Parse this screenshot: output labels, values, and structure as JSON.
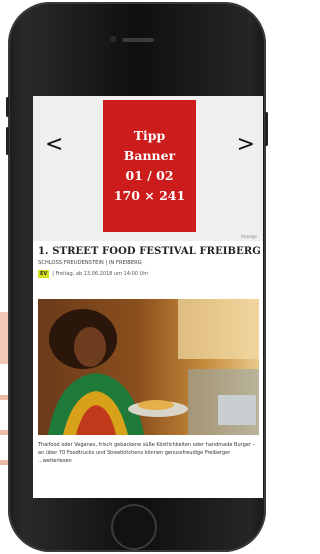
{
  "banner": {
    "line1": "Tipp",
    "line2": "Banner",
    "line3": "01 / 02",
    "line4": "170 × 241",
    "prev_arrow": "<",
    "next_arrow": ">",
    "tiny_label": "Anzeige"
  },
  "article": {
    "title": "1. STREET FOOD FESTIVAL FREIBERG",
    "subtitle": "SCHLOSS FREUDENSTEIN | IN FREIBERG",
    "badge": "EV",
    "date": "| Freitag, ab 13.06.2018 um 14:00 Uhr",
    "description": "Thaifood oder Veganes, frisch gebackene süße Köstlichkeiten oder handmade Burger – an über 70 Foodtrucks und Streetkitchens können genussfreudige Freiberger ...weiterlesen"
  },
  "colors": {
    "banner_red": "#cd1c1c",
    "badge_yellow": "#d4e01a"
  }
}
